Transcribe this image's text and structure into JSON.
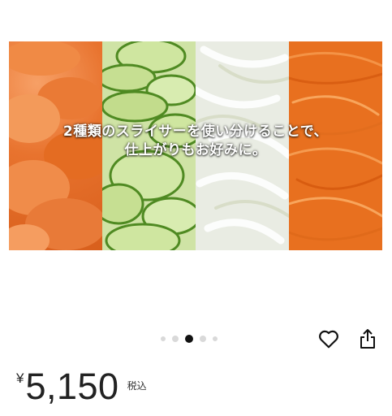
{
  "hero": {
    "caption": "2種類のスライサーを使い分けることで、\n仕上がりもお好みに。"
  },
  "carousel": {
    "total": 5,
    "active_index": 2
  },
  "actions": {
    "favorite_icon": "heart-outline-icon",
    "share_icon": "share-icon"
  },
  "price": {
    "currency": "¥",
    "amount": "5,150",
    "tax_label": "税込"
  },
  "colors": {
    "carrot": "#e8701f",
    "cucumber": "#8fc04a",
    "onion": "#e9ece3",
    "dot_active": "#111111",
    "dot_inactive": "#d9d9d9"
  }
}
